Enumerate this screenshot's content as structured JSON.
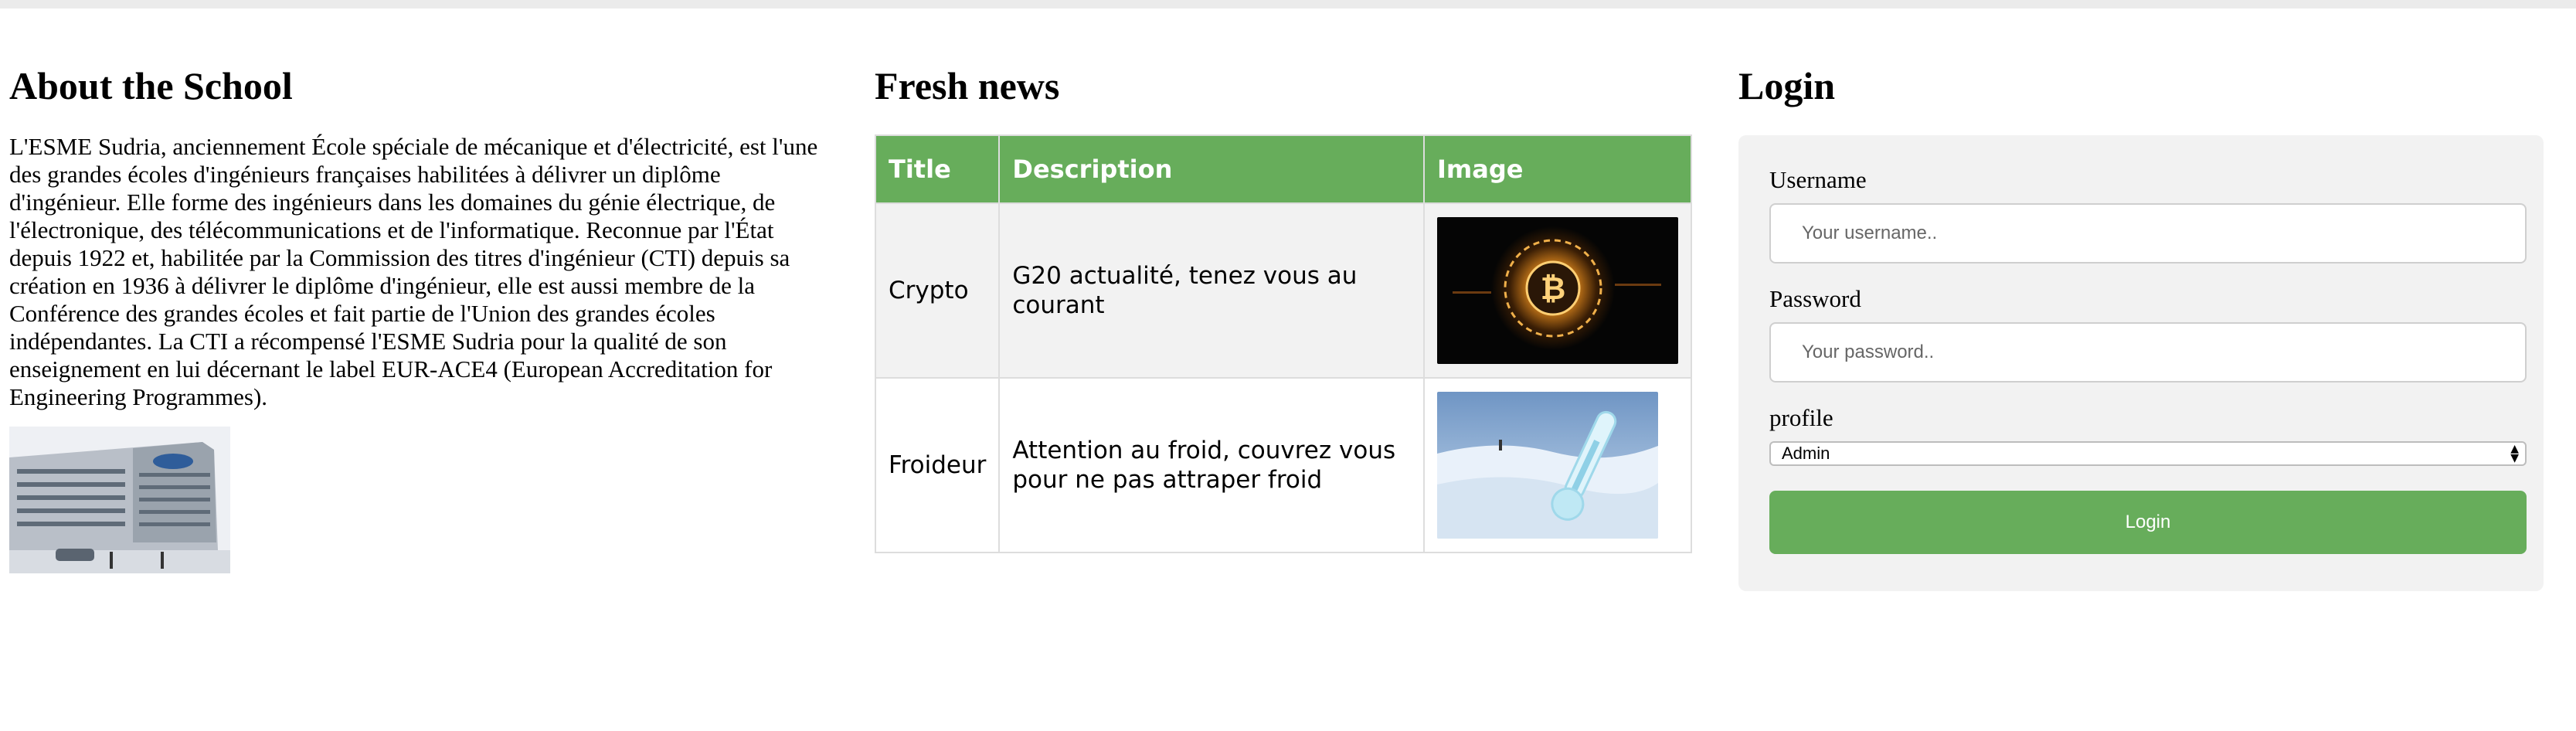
{
  "about": {
    "title": "About the School",
    "paragraph": "L'ESME Sudria, anciennement École spéciale de mécanique et d'électricité, est l'une des grandes écoles d'ingénieurs françaises habilitées à délivrer un diplôme d'ingénieur. Elle forme des ingénieurs dans les domaines du génie électrique, de l'électronique, des télécommunications et de l'informatique. Reconnue par l'État depuis 1922 et, habilitée par la Commission des titres d'ingénieur (CTI) depuis sa création en 1936 à délivrer le diplôme d'ingénieur, elle est aussi membre de la Conférence des grandes écoles et fait partie de l'Union des grandes écoles indépendantes. La CTI a récompensé l'ESME Sudria pour la qualité de son enseignement en lui décernant le label EUR-ACE4 (European Accreditation for Engineering Programmes)."
  },
  "news": {
    "title": "Fresh news",
    "headers": [
      "Title",
      "Description",
      "Image"
    ],
    "rows": [
      {
        "title": "Crypto",
        "description": "G20 actualité, tenez vous au courant"
      },
      {
        "title": "Froideur",
        "description": "Attention au froid, couvrez vous pour ne pas attraper froid"
      }
    ]
  },
  "login": {
    "title": "Login",
    "username_label": "Username",
    "username_placeholder": "Your username..",
    "password_label": "Password",
    "password_placeholder": "Your password..",
    "profile_label": "profile",
    "profile_selected": "Admin",
    "submit_label": "Login"
  },
  "colors": {
    "accent": "#67ad5b",
    "panel": "#f2f2f2",
    "border": "#dddddd"
  }
}
